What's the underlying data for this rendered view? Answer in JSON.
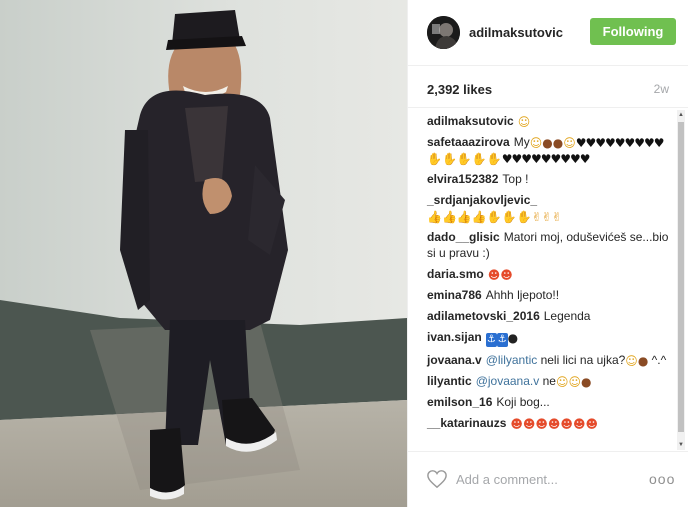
{
  "post": {
    "username": "adilmaksutovic",
    "follow_label": "Following",
    "likes": "2,392 likes",
    "age": "2w",
    "comments": [
      {
        "author": "adilmaksutovic",
        "text": "",
        "emoji": [
          {
            "glyph": "☺",
            "kind": "smile"
          }
        ]
      },
      {
        "author": "safetaaazirova",
        "text": "My",
        "emoji": [
          {
            "glyph": "☺",
            "kind": "smile"
          },
          {
            "glyph": " ",
            "kind": "space"
          },
          {
            "glyph": "●",
            "kind": "monkey"
          },
          {
            "glyph": "●",
            "kind": "monkey"
          },
          {
            "glyph": "☺",
            "kind": "smile"
          },
          {
            "glyph": "♥♥♥♥♥♥♥♥♥",
            "kind": "heart"
          },
          {
            "glyph": "✋✋✋✋✋",
            "kind": "hand"
          },
          {
            "glyph": "♥♥♥♥♥♥♥♥♥",
            "kind": "heart"
          }
        ]
      },
      {
        "author": "elvira152382",
        "text": "Top !",
        "emoji": []
      },
      {
        "author": "_srdjanjakovljevic_",
        "text": "",
        "emoji": [
          {
            "glyph": "👍👍👍👍✋✋✋✌✌✌",
            "kind": "hand"
          }
        ]
      },
      {
        "author": "dado__glisic",
        "text": "Matori moj, oduševićeš se...bio si u pravu :)",
        "emoji": []
      },
      {
        "author": "daria.smo",
        "text": "",
        "emoji": [
          {
            "glyph": "☻☻",
            "kind": "fire"
          }
        ]
      },
      {
        "author": "emina786",
        "text": "Ahhh ljepoto!!",
        "emoji": []
      },
      {
        "author": "adilametovski_2016",
        "text": "Legenda",
        "emoji": []
      },
      {
        "author": "ivan.sijan",
        "text": "",
        "emoji": [
          {
            "glyph": "⚓",
            "kind": "blue"
          },
          {
            "glyph": "⚓",
            "kind": "blue"
          },
          {
            "glyph": "●",
            "kind": "bomb"
          }
        ]
      },
      {
        "author": "jovaana.v",
        "mention": "@lilyantic",
        "text": "neli lici na ujka?",
        "emoji": [
          {
            "glyph": "☺",
            "kind": "smile"
          },
          {
            "glyph": "●",
            "kind": "monkey"
          }
        ],
        "tail": "^.^"
      },
      {
        "author": "lilyantic",
        "mention": "@jovaana.v",
        "text": "ne",
        "emoji": [
          {
            "glyph": "☺",
            "kind": "smile"
          },
          {
            "glyph": "☺",
            "kind": "smile"
          },
          {
            "glyph": "●",
            "kind": "monkey"
          }
        ]
      },
      {
        "author": "emilson_16",
        "text": "Koji bog...",
        "emoji": []
      },
      {
        "author": "__katarinauzs",
        "text": "",
        "emoji": [
          {
            "glyph": "☻☻☻☻☻☻☻",
            "kind": "fire"
          }
        ]
      }
    ],
    "comment_placeholder": "Add a comment...",
    "more_label": "ooo"
  },
  "colors": {
    "follow_button": "#70c050",
    "mention": "#3f729b",
    "muted": "#a5a7aa"
  },
  "icons": {
    "like": "heart-outline-icon",
    "more": "more-options-icon",
    "avatar": "profile-avatar"
  }
}
